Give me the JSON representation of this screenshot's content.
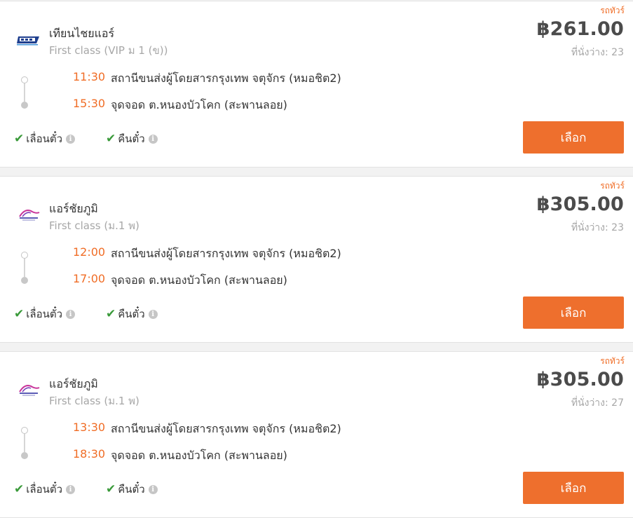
{
  "results": [
    {
      "bus_type": "รถทัวร์",
      "operator": "เทียนไชยแอร์",
      "bus_class": "First class (VIP ม 1 (ข))",
      "logo_icon": "tienchai-air-logo-icon",
      "price": "฿261.00",
      "seats": "ที่นั่งว่าง: 23",
      "depart_time": "11:30",
      "depart_stop": "สถานีขนส่งผู้โดยสารกรุงเทพ จตุจักร (หมอชิต2)",
      "arrive_time": "15:30",
      "arrive_stop": "จุดจอด ต.หนองบัวโคก (สะพานลอย)",
      "feature_1": "เลื่อนตั๋ว",
      "feature_2": "คืนตั๋ว",
      "select_label": "เลือก"
    },
    {
      "bus_type": "รถทัวร์",
      "operator": "แอร์ชัยภูมิ",
      "bus_class": "First class (ม.1 พ)",
      "logo_icon": "air-chaiyaphum-logo-icon",
      "price": "฿305.00",
      "seats": "ที่นั่งว่าง: 23",
      "depart_time": "12:00",
      "depart_stop": "สถานีขนส่งผู้โดยสารกรุงเทพ จตุจักร (หมอชิต2)",
      "arrive_time": "17:00",
      "arrive_stop": "จุดจอด ต.หนองบัวโคก (สะพานลอย)",
      "feature_1": "เลื่อนตั๋ว",
      "feature_2": "คืนตั๋ว",
      "select_label": "เลือก"
    },
    {
      "bus_type": "รถทัวร์",
      "operator": "แอร์ชัยภูมิ",
      "bus_class": "First class (ม.1 พ)",
      "logo_icon": "air-chaiyaphum-logo-icon",
      "price": "฿305.00",
      "seats": "ที่นั่งว่าง: 27",
      "depart_time": "13:30",
      "depart_stop": "สถานีขนส่งผู้โดยสารกรุงเทพ จตุจักร (หมอชิต2)",
      "arrive_time": "18:30",
      "arrive_stop": "จุดจอด ต.หนองบัวโคก (สะพานลอย)",
      "feature_1": "เลื่อนตั๋ว",
      "feature_2": "คืนตั๋ว",
      "select_label": "เลือก"
    }
  ],
  "colors": {
    "accent": "#ee6f2d",
    "check": "#3a9a3a",
    "price": "#4b4b4b"
  }
}
